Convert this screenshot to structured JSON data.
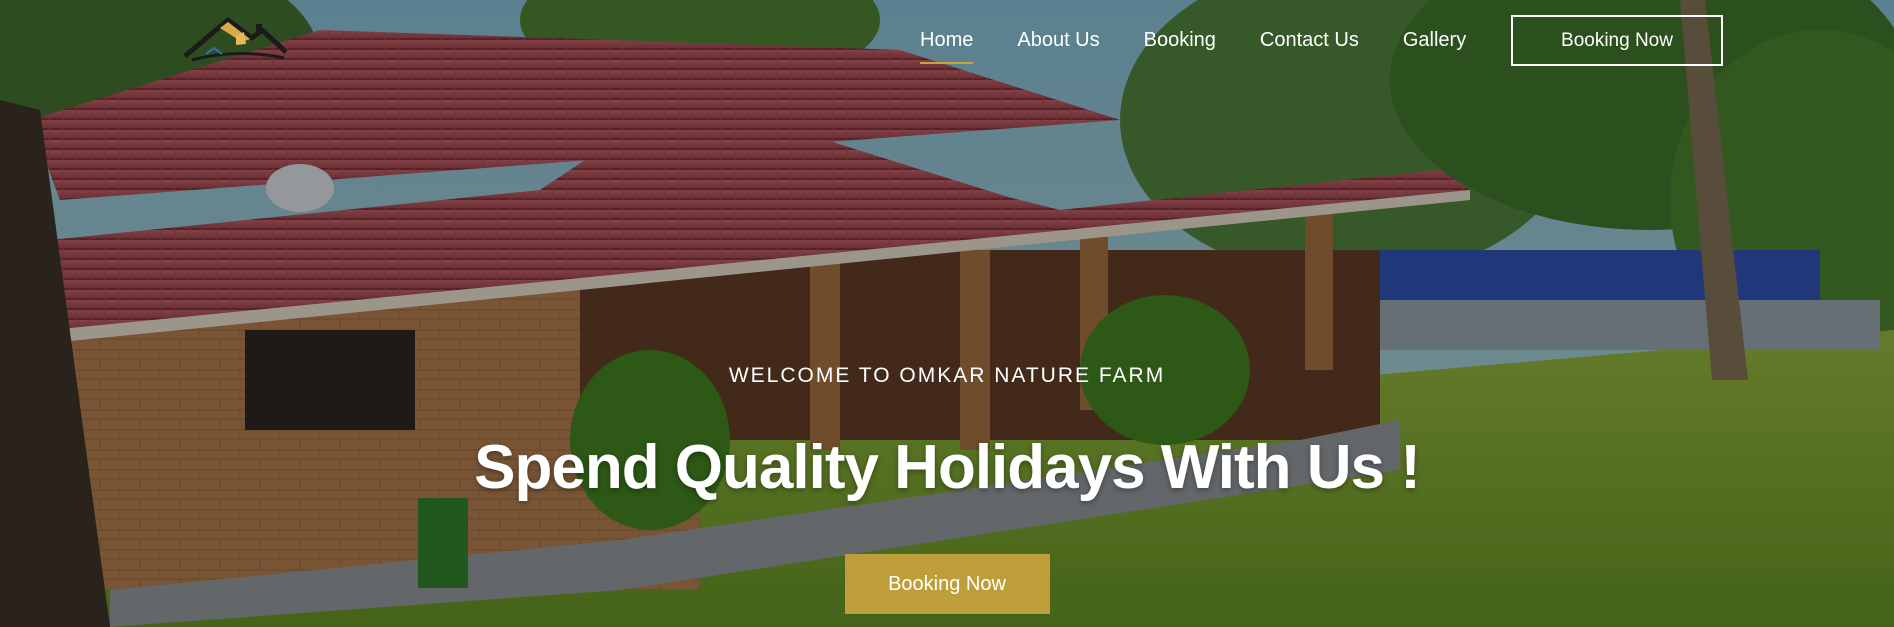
{
  "brand": {
    "logo_icon": "farmhouse-roof-logo"
  },
  "nav": {
    "items": [
      {
        "label": "Home",
        "active": true
      },
      {
        "label": "About Us",
        "active": false
      },
      {
        "label": "Booking",
        "active": false
      },
      {
        "label": "Contact Us",
        "active": false
      },
      {
        "label": "Gallery",
        "active": false
      }
    ],
    "cta_label": "Booking Now"
  },
  "hero": {
    "eyebrow": "WELCOME TO OMKAR NATURE FARM",
    "headline": "Spend Quality Holidays With Us !",
    "cta_label": "Booking Now"
  },
  "colors": {
    "accent": "#bd9e3a",
    "active_underline": "#c9a43a",
    "text": "#ffffff"
  }
}
